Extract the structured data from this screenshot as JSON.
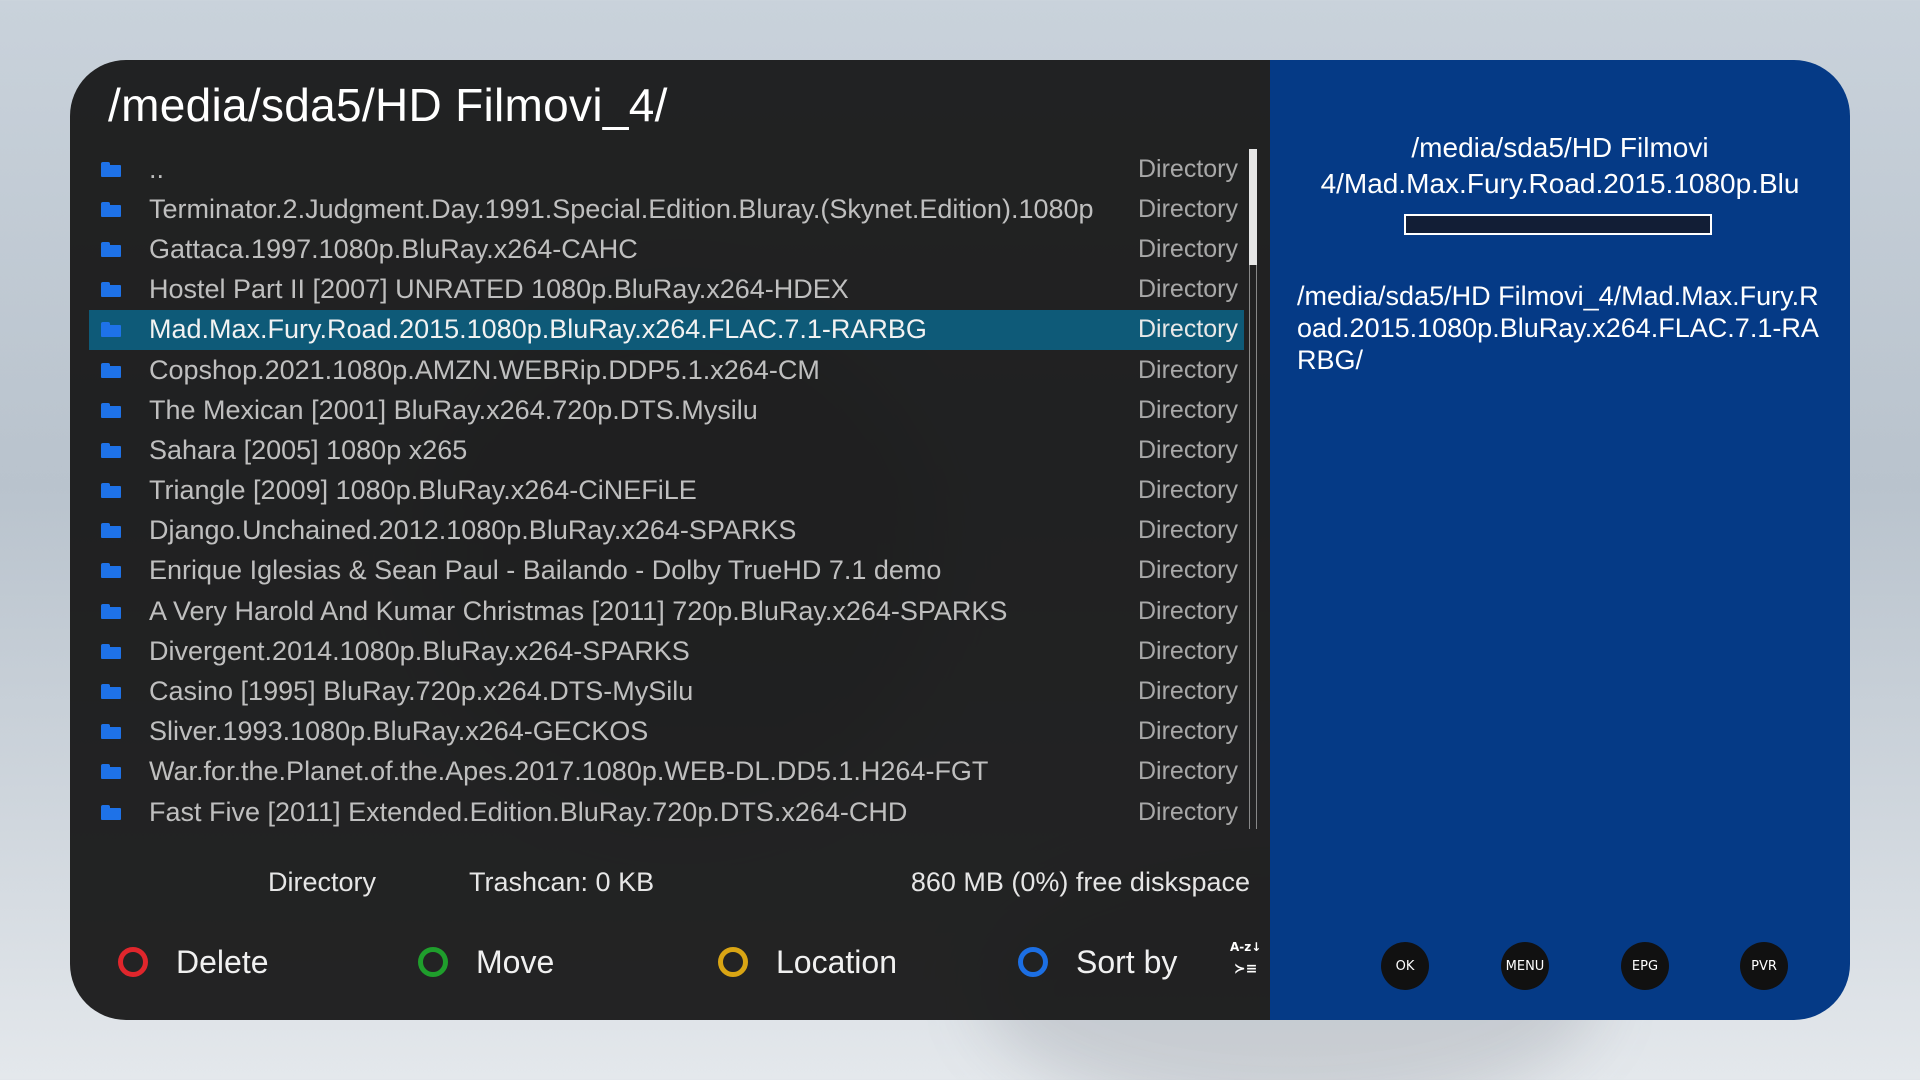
{
  "header": {
    "path": "/media/sda5/HD Filmovi_4/"
  },
  "list": {
    "selected_index": 4,
    "items": [
      {
        "name": "..",
        "type": "Directory"
      },
      {
        "name": "Terminator.2.Judgment.Day.1991.Special.Edition.Bluray.(Skynet.Edition).1080p",
        "type": "Directory"
      },
      {
        "name": "Gattaca.1997.1080p.BluRay.x264-CAHC",
        "type": "Directory"
      },
      {
        "name": "Hostel Part II [2007] UNRATED 1080p.BluRay.x264-HDEX",
        "type": "Directory"
      },
      {
        "name": "Mad.Max.Fury.Road.2015.1080p.BluRay.x264.FLAC.7.1-RARBG",
        "type": "Directory"
      },
      {
        "name": "Copshop.2021.1080p.AMZN.WEBRip.DDP5.1.x264-CM",
        "type": "Directory"
      },
      {
        "name": "The Mexican [2001] BluRay.x264.720p.DTS.Mysilu",
        "type": "Directory"
      },
      {
        "name": "Sahara [2005] 1080p x265",
        "type": "Directory"
      },
      {
        "name": "Triangle [2009] 1080p.BluRay.x264-CiNEFiLE",
        "type": "Directory"
      },
      {
        "name": "Django.Unchained.2012.1080p.BluRay.x264-SPARKS",
        "type": "Directory"
      },
      {
        "name": "Enrique Iglesias & Sean Paul - Bailando - Dolby TrueHD 7.1 demo",
        "type": "Directory"
      },
      {
        "name": "A Very Harold And Kumar Christmas [2011] 720p.BluRay.x264-SPARKS",
        "type": "Directory"
      },
      {
        "name": "Divergent.2014.1080p.BluRay.x264-SPARKS",
        "type": "Directory"
      },
      {
        "name": "Casino [1995] BluRay.720p.x264.DTS-MySilu",
        "type": "Directory"
      },
      {
        "name": "Sliver.1993.1080p.BluRay.x264-GECKOS",
        "type": "Directory"
      },
      {
        "name": "War.for.the.Planet.of.the.Apes.2017.1080p.WEB-DL.DD5.1.H264-FGT",
        "type": "Directory"
      },
      {
        "name": "Fast Five [2011] Extended.Edition.BluRay.720p.DTS.x264-CHD",
        "type": "Directory"
      }
    ]
  },
  "status": {
    "type": "Directory",
    "trashcan": "Trashcan: 0 KB",
    "diskspace": "860 MB (0%) free diskspace"
  },
  "buttons": {
    "red": "Delete",
    "green": "Move",
    "yellow": "Location",
    "blue": "Sort by",
    "sort_icon_top": "A-z↓",
    "sort_icon_bottom": "≻≡"
  },
  "colors": {
    "red": "#e0262c",
    "green": "#1f9e2c",
    "yellow": "#d9a514",
    "blue": "#1c6fe3",
    "selection": "#0e5a78",
    "right_panel": "#053a86"
  },
  "info_panel": {
    "title": "/media/sda5/HD Filmovi 4/Mad.Max.Fury.Road.2015.1080p.Blu",
    "full_path": "/media/sda5/HD Filmovi_4/Mad.Max.Fury.Road.2015.1080p.BluRay.x264.FLAC.7.1-RARBG/",
    "progress": 0
  },
  "remote_keys": [
    "OK",
    "MENU",
    "EPG",
    "PVR"
  ]
}
